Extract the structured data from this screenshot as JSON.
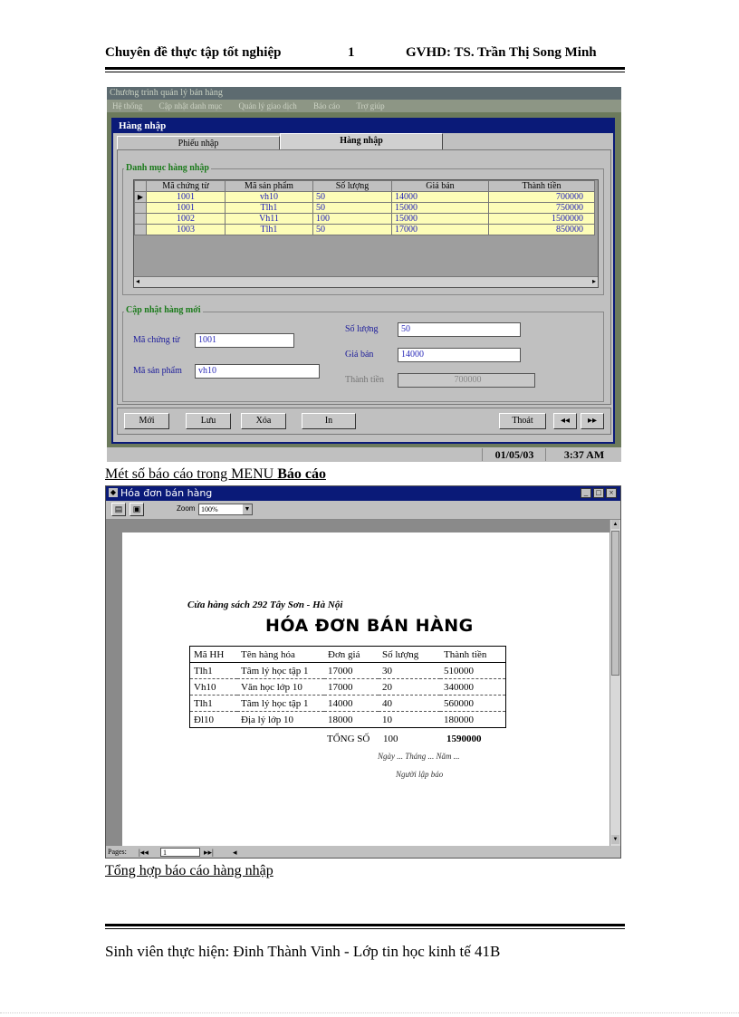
{
  "header": {
    "left": "Chuyên đề thực tập tốt nghiệp",
    "center": "1",
    "right": "GVHD: TS. Trần Thị Song Minh"
  },
  "screen1": {
    "app_title": "Chương trình quản lý bán hàng",
    "menu": [
      "Hệ thống",
      "Cập nhật danh mục",
      "Quản lý giao dịch",
      "Báo cáo",
      "Trợ giúp"
    ],
    "window_title": "Hàng nhập",
    "tabs": [
      "Phiếu nhập",
      "Hàng nhập"
    ],
    "grid_group": "Danh mục hàng nhập",
    "columns": [
      "Mã chứng từ",
      "Mã sản phẩm",
      "Số lượng",
      "Giá bán",
      "Thành tiền"
    ],
    "rows": [
      [
        "1001",
        "vh10",
        "50",
        "14000",
        "700000"
      ],
      [
        "1001",
        "Tlh1",
        "50",
        "15000",
        "750000"
      ],
      [
        "1002",
        "Vh11",
        "100",
        "15000",
        "1500000"
      ],
      [
        "1003",
        "Tlh1",
        "50",
        "17000",
        "850000"
      ]
    ],
    "form_group": "Cập nhật hàng mới",
    "form": {
      "ma_chung_tu_label": "Mã chứng từ",
      "ma_chung_tu": "1001",
      "ma_san_pham_label": "Mã sản phẩm",
      "ma_san_pham": "vh10",
      "so_luong_label": "Số lượng",
      "so_luong": "50",
      "gia_ban_label": "Giá bán",
      "gia_ban": "14000",
      "thanh_tien_label": "Thành tiền",
      "thanh_tien": "700000"
    },
    "buttons": {
      "new": "Mới",
      "save": "Lưu",
      "delete": "Xóa",
      "print": "In",
      "exit": "Thoát",
      "prev": "◂◂",
      "next": "▸▸"
    },
    "status_date": "01/05/03",
    "status_time": "3:37 AM"
  },
  "caption1_prefix": "Mét số báo cáo trong MENU ",
  "caption1_bold": "Báo cáo",
  "screen2": {
    "window_title": "Hóa đơn bán hàng",
    "zoom_label": "Zoom",
    "zoom_value": "100%",
    "store": "Cửa hàng sách 292 Tây Sơn - Hà Nội",
    "heading": "HÓA ĐƠN BÁN HÀNG",
    "columns": [
      "Mã HH",
      "Tên hàng hóa",
      "Đơn giá",
      "Số lượng",
      "Thành tiền"
    ],
    "rows": [
      [
        "Tlh1",
        "Tâm lý học tập 1",
        "17000",
        "30",
        "510000"
      ],
      [
        "Vh10",
        "Văn học lớp 10",
        "17000",
        "20",
        "340000"
      ],
      [
        "Tlh1",
        "Tâm lý học tập 1",
        "14000",
        "40",
        "560000"
      ],
      [
        "Đl10",
        "Địa lý lớp 10",
        "18000",
        "10",
        "180000"
      ]
    ],
    "total_label": "TỔNG SỐ",
    "total_qty": "100",
    "total_amount": "1590000",
    "date_line": "Ngày ... Tháng ... Năm ...",
    "signer": "Người lập báo",
    "pages_label": "Pages:",
    "page_value": "1"
  },
  "caption2": "Tổng hợp báo cáo hàng nhập",
  "footer": "Sinh viên thực hiện: Đinh Thành Vinh - Lớp tin học kinh tế 41B"
}
